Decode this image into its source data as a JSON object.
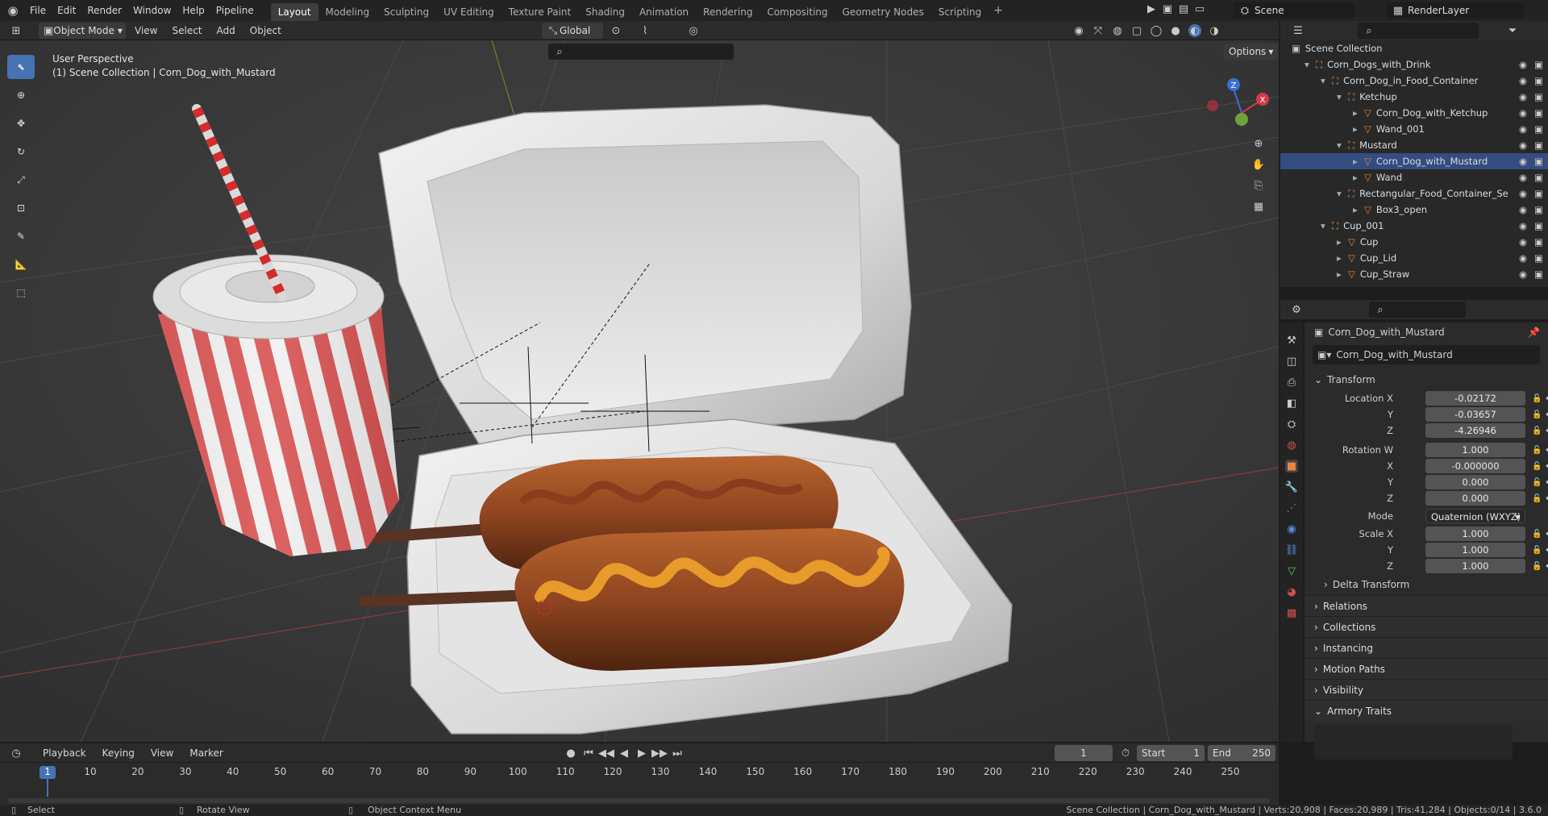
{
  "top_menu": [
    "File",
    "Edit",
    "Render",
    "Window",
    "Help",
    "Pipeline"
  ],
  "workspaces": [
    "Layout",
    "Modeling",
    "Sculpting",
    "UV Editing",
    "Texture Paint",
    "Shading",
    "Animation",
    "Rendering",
    "Compositing",
    "Geometry Nodes",
    "Scripting"
  ],
  "active_workspace": "Layout",
  "scene_name": "Scene",
  "renderlayer_name": "RenderLayer",
  "viewport": {
    "mode": "Object Mode",
    "menus": [
      "View",
      "Select",
      "Add",
      "Object"
    ],
    "transform_orientation": "Global",
    "options_label": "Options",
    "overlay_title": "User Perspective",
    "overlay_subtitle": "(1) Scene Collection | Corn_Dog_with_Mustard",
    "gizmo_axes": [
      "X",
      "Y",
      "Z"
    ]
  },
  "outliner": {
    "root": "Scene Collection",
    "items": [
      {
        "label": "Corn_Dogs_with_Drink",
        "depth": 0,
        "type": "collection"
      },
      {
        "label": "Corn_Dog_in_Food_Container",
        "depth": 1,
        "type": "collection"
      },
      {
        "label": "Ketchup",
        "depth": 2,
        "type": "collection"
      },
      {
        "label": "Corn_Dog_with_Ketchup",
        "depth": 3,
        "type": "mesh"
      },
      {
        "label": "Wand_001",
        "depth": 3,
        "type": "mesh"
      },
      {
        "label": "Mustard",
        "depth": 2,
        "type": "collection"
      },
      {
        "label": "Corn_Dog_with_Mustard",
        "depth": 3,
        "type": "mesh"
      },
      {
        "label": "Wand",
        "depth": 3,
        "type": "mesh"
      },
      {
        "label": "Rectangular_Food_Container_Se",
        "depth": 2,
        "type": "collection"
      },
      {
        "label": "Box3_open",
        "depth": 3,
        "type": "mesh"
      },
      {
        "label": "Cup_001",
        "depth": 1,
        "type": "collection"
      },
      {
        "label": "Cup",
        "depth": 2,
        "type": "mesh"
      },
      {
        "label": "Cup_Lid",
        "depth": 2,
        "type": "mesh"
      },
      {
        "label": "Cup_Straw",
        "depth": 2,
        "type": "mesh"
      }
    ]
  },
  "properties": {
    "object_name": "Corn_Dog_with_Mustard",
    "datablock_name": "Corn_Dog_with_Mustard",
    "transform_label": "Transform",
    "rows": [
      {
        "label": "Location X",
        "value": "-0.02172"
      },
      {
        "label": "Y",
        "value": "-0.03657"
      },
      {
        "label": "Z",
        "value": "-4.26946"
      },
      {
        "label": "Rotation W",
        "value": "1.000"
      },
      {
        "label": "X",
        "value": "-0.000000"
      },
      {
        "label": "Y",
        "value": "0.000"
      },
      {
        "label": "Z",
        "value": "0.000"
      }
    ],
    "mode_label": "Mode",
    "mode_value": "Quaternion (WXYZ)",
    "scale_rows": [
      {
        "label": "Scale X",
        "value": "1.000"
      },
      {
        "label": "Y",
        "value": "1.000"
      },
      {
        "label": "Z",
        "value": "1.000"
      }
    ],
    "delta_label": "Delta Transform",
    "panels": [
      "Relations",
      "Collections",
      "Instancing",
      "Motion Paths",
      "Visibility",
      "Armory Traits"
    ]
  },
  "timeline": {
    "menus": [
      "Playback",
      "Keying",
      "View",
      "Marker"
    ],
    "current_frame": "1",
    "start_label": "Start",
    "start": "1",
    "end_label": "End",
    "end": "250",
    "ticks": [
      "1",
      "10",
      "20",
      "30",
      "40",
      "50",
      "60",
      "70",
      "80",
      "90",
      "100",
      "110",
      "120",
      "130",
      "140",
      "150",
      "160",
      "170",
      "180",
      "190",
      "200",
      "210",
      "220",
      "230",
      "240",
      "250"
    ]
  },
  "status": {
    "select": "Select",
    "rotate": "Rotate View",
    "context": "Object Context Menu",
    "stats": "Scene Collection | Corn_Dog_with_Mustard | Verts:20,908 | Faces:20,989 | Tris:41,284 | Objects:0/14 | 3.6.0"
  },
  "colors": {
    "accent": "#4772b3",
    "mesh_icon": "#e8853c",
    "collection_icon": "#e8853c"
  }
}
